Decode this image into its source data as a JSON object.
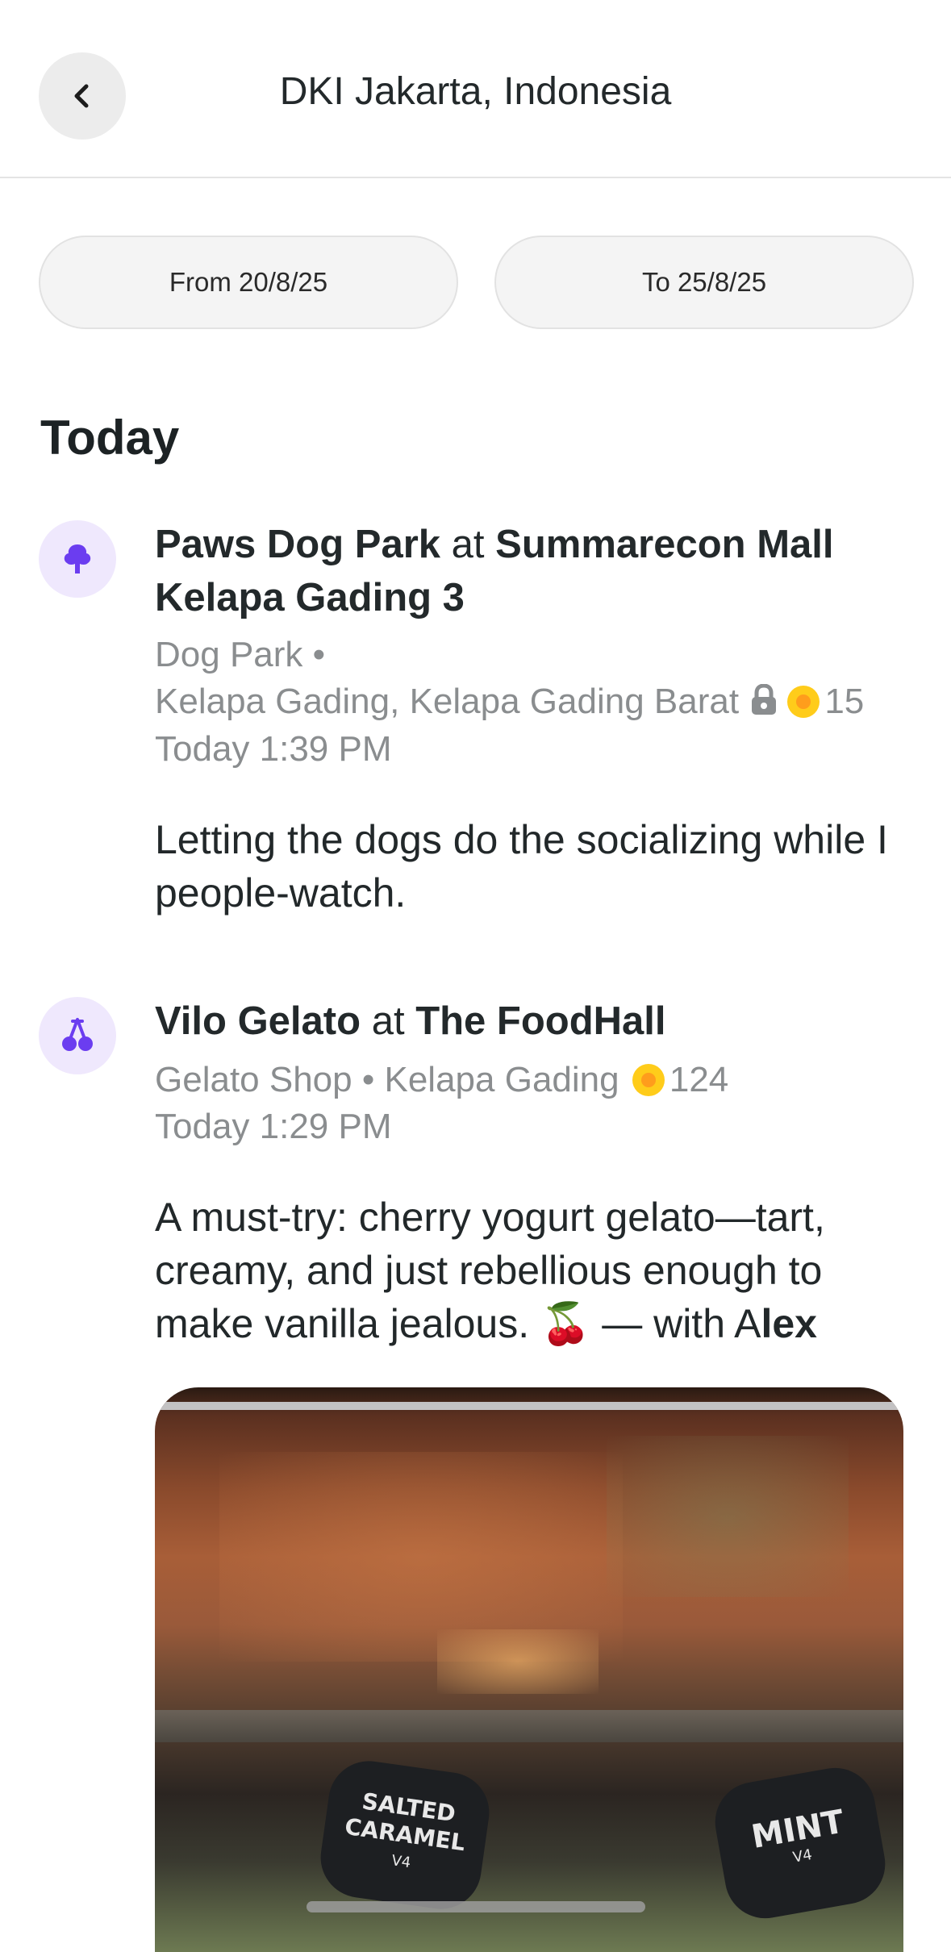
{
  "header": {
    "title": "DKI Jakarta, Indonesia"
  },
  "filters": {
    "from_label": "From 20/8/25",
    "to_label": "To 25/8/25"
  },
  "section": {
    "title": "Today"
  },
  "entries": [
    {
      "icon": "tree-icon",
      "place": "Paws Dog Park",
      "at": "at",
      "venue": "Summarecon Mall Kelapa Gading 3",
      "category": "Dog Park",
      "location": "Kelapa Gading, Kelapa Gading Barat",
      "private": true,
      "coins": "15",
      "time": "Today 1:39 PM",
      "text": "Letting the dogs do the socializing while I people-watch."
    },
    {
      "icon": "cherries-icon",
      "place": "Vilo Gelato",
      "at": "at",
      "venue": "The FoodHall",
      "category": "Gelato Shop",
      "location": "Kelapa Gading",
      "coins": "124",
      "time": "Today 1:29 PM",
      "text_before": "A must-try: cherry yogurt gelato—tart, creamy, and just rebellious enough to make vanilla jealous. ",
      "emoji": "🍒",
      "with_text": " — with A",
      "with_name": "lex",
      "photo_signs": [
        "SALTED CARAMEL",
        "MINT"
      ],
      "photo_sign_small": [
        "V4",
        "V4"
      ]
    }
  ],
  "colors": {
    "accent": "#6b3df0",
    "icon_bg": "#efe8fd",
    "coin": "#ffcc1a",
    "meta_text": "#8a8d8f"
  }
}
